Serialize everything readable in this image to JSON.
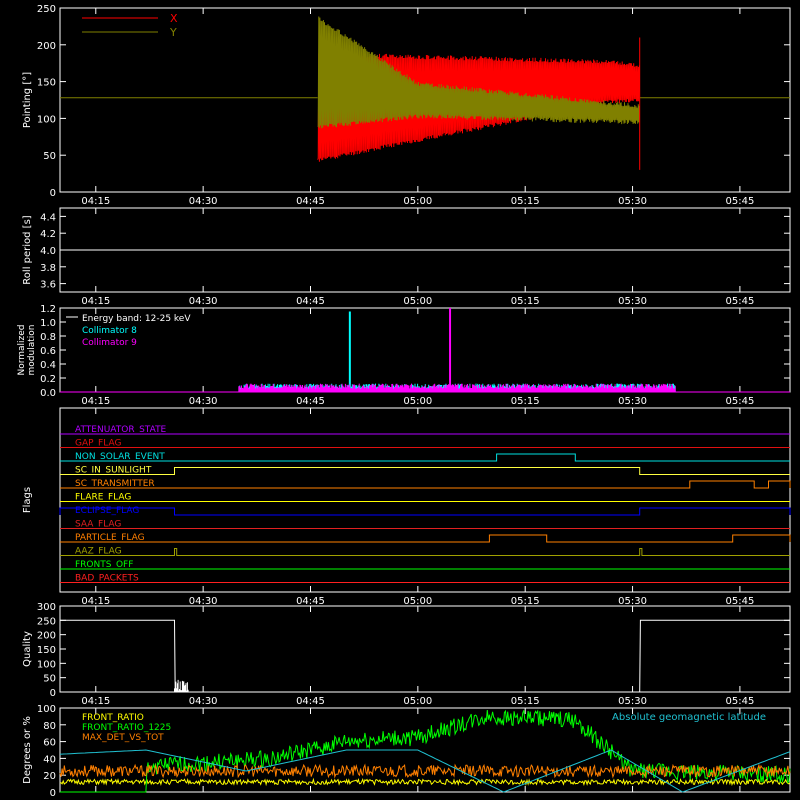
{
  "chart_data": [
    {
      "id": "pointing",
      "type": "line",
      "ylabel": "Pointing [°]",
      "ylim": [
        0,
        250
      ],
      "yticks": [
        0,
        50,
        100,
        150,
        200,
        250
      ],
      "xlim_minutes": [
        250,
        352
      ],
      "xticks": [
        "04:15",
        "04:30",
        "04:45",
        "05:00",
        "05:15",
        "05:30",
        "05:45"
      ],
      "legend_position": "top-left",
      "series": [
        {
          "name": "X",
          "color": "#ff0000",
          "pre_value": 128,
          "band_x": [
            286,
            327,
            336
          ],
          "band_low": [
            40,
            120,
            123
          ],
          "band_high": [
            190,
            180,
            170
          ]
        },
        {
          "name": "Y",
          "color": "#808000",
          "pre_value": 128,
          "band_x": [
            286,
            300,
            336
          ],
          "band_low": [
            85,
            100,
            90
          ],
          "band_high": [
            240,
            150,
            115
          ]
        }
      ],
      "segment_minutes": [
        286,
        331
      ]
    },
    {
      "id": "roll",
      "type": "line",
      "ylabel": "Roll period [s]",
      "ylim": [
        3.5,
        4.5
      ],
      "yticks": [
        3.6,
        3.8,
        4.0,
        4.2,
        4.4
      ],
      "series": [
        {
          "name": "",
          "color": "#ffffff",
          "x": [
            250,
            352
          ],
          "y": [
            4.0,
            4.0
          ]
        }
      ]
    },
    {
      "id": "modulation",
      "type": "line",
      "ylabel": "Normalized modulation",
      "ylim": [
        0,
        1.2
      ],
      "yticks": [
        0.0,
        0.2,
        0.4,
        0.6,
        0.8,
        1.0,
        1.2
      ],
      "legend_title": "Energy band: 12-25 keV",
      "series": [
        {
          "name": "Collimator 8",
          "color": "#00ffff",
          "baseline": 0.08,
          "range": [
            275,
            336
          ],
          "spikes": [
            {
              "x": 290.5,
              "y": 1.15
            }
          ]
        },
        {
          "name": "Collimator 9",
          "color": "#ff00ff",
          "baseline": 0.08,
          "range": [
            275,
            336
          ],
          "spikes": [
            {
              "x": 304.5,
              "y": 1.2
            }
          ]
        }
      ]
    },
    {
      "id": "flags",
      "type": "line",
      "ylabel": "Flags",
      "series": [
        {
          "name": "ATTENUATOR_STATE",
          "color": "#b000ff",
          "low_steps": []
        },
        {
          "name": "GAP_FLAG",
          "color": "#e01010",
          "low_steps": []
        },
        {
          "name": "NON_SOLAR_EVENT",
          "color": "#00e0e0",
          "high_steps": [
            [
              311,
              322
            ]
          ]
        },
        {
          "name": "SC_IN_SUNLIGHT",
          "color": "#ffff40",
          "high_steps": [
            [
              266,
              331
            ]
          ]
        },
        {
          "name": "SC_TRANSMITTER",
          "color": "#ff8000",
          "high_steps": [
            [
              338,
              347
            ],
            [
              349,
              352
            ]
          ]
        },
        {
          "name": "FLARE_FLAG",
          "color": "#ffff00",
          "low_steps": []
        },
        {
          "name": "ECLIPSE_FLAG",
          "color": "#0000ff",
          "high_steps": [
            [
              250,
              266
            ],
            [
              331,
              352
            ]
          ]
        },
        {
          "name": "SAA_FLAG",
          "color": "#e02020",
          "low_steps": []
        },
        {
          "name": "PARTICLE_FLAG",
          "color": "#ff7f00",
          "high_steps": [
            [
              310,
              318
            ],
            [
              344,
              352
            ]
          ]
        },
        {
          "name": "AAZ_FLAG",
          "color": "#a0a000",
          "high_steps": [
            [
              266,
              266.3
            ],
            [
              331,
              331.3
            ]
          ]
        },
        {
          "name": "FRONTS_OFF",
          "color": "#00ff00",
          "low_steps": []
        },
        {
          "name": "BAD_PACKETS",
          "color": "#ff2020",
          "low_steps": []
        }
      ]
    },
    {
      "id": "quality",
      "type": "line",
      "ylabel": "Quality",
      "ylim": [
        0,
        300
      ],
      "yticks": [
        0,
        50,
        100,
        150,
        200,
        250,
        300
      ],
      "series": [
        {
          "name": "",
          "color": "#ffffff",
          "x": [
            250,
            266,
            266.1,
            331,
            331.1,
            352
          ],
          "y": [
            250,
            250,
            0,
            0,
            250,
            250
          ]
        }
      ]
    },
    {
      "id": "ratios",
      "type": "line",
      "ylabel": "Degrees or %",
      "ylim": [
        0,
        100
      ],
      "yticks": [
        0,
        20,
        40,
        60,
        80,
        100
      ],
      "right_label": "Absolute geomagnetic latitude",
      "series": [
        {
          "name": "FRONT_RATIO",
          "color": "#ffff00",
          "level": 12
        },
        {
          "name": "FRONT_RATIO_1225",
          "color": "#00ff00",
          "x": [
            262,
            280,
            290,
            300,
            310,
            322,
            326,
            330,
            352
          ],
          "y": [
            30,
            40,
            60,
            65,
            90,
            85,
            55,
            25,
            20
          ]
        },
        {
          "name": "MAX_DET_VS_TOT",
          "color": "#ff8000",
          "level": 25
        },
        {
          "name": "Absolute geomagnetic latitude",
          "color": "#20c0d0",
          "x": [
            250,
            262,
            276,
            290,
            300,
            312,
            327,
            337,
            352
          ],
          "y": [
            45,
            50,
            25,
            50,
            50,
            0,
            50,
            0,
            48
          ]
        }
      ]
    }
  ]
}
